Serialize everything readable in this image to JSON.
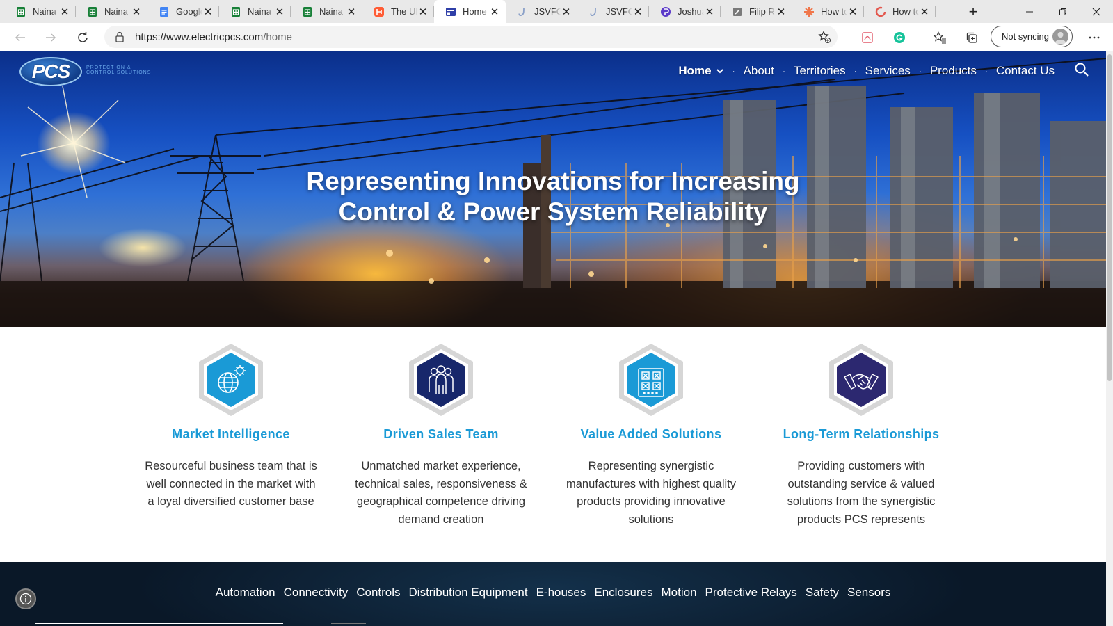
{
  "browser": {
    "tabs": [
      {
        "label": "Naina",
        "icon": "sheets",
        "active": false
      },
      {
        "label": "Naina",
        "icon": "sheets",
        "active": false
      },
      {
        "label": "Google",
        "icon": "docs",
        "active": false
      },
      {
        "label": "Naina",
        "icon": "sheets",
        "active": false
      },
      {
        "label": "Naina",
        "icon": "sheets",
        "active": false
      },
      {
        "label": "The Ul",
        "icon": "hubspot",
        "active": false
      },
      {
        "label": "Home",
        "icon": "site",
        "active": true
      },
      {
        "label": "JSVFO",
        "icon": "jsv",
        "active": false
      },
      {
        "label": "JSVFO",
        "icon": "jsv",
        "active": false
      },
      {
        "label": "Joshua",
        "icon": "purple",
        "active": false
      },
      {
        "label": "Filip R",
        "icon": "gray",
        "active": false
      },
      {
        "label": "How to",
        "icon": "orange",
        "active": false
      },
      {
        "label": "How to",
        "icon": "red",
        "active": false
      }
    ],
    "address": {
      "host": "https://www.electricpcs.com",
      "path": "/home"
    },
    "profile_label": "Not syncing"
  },
  "site": {
    "logo_text": "PCS",
    "logo_tagline": "PROTECTION & CONTROL SOLUTIONS",
    "nav": [
      {
        "label": "Home",
        "active": true
      },
      {
        "label": "About",
        "active": false
      },
      {
        "label": "Territories",
        "active": false
      },
      {
        "label": "Services",
        "active": false
      },
      {
        "label": "Products",
        "active": false
      },
      {
        "label": "Contact Us",
        "active": false
      }
    ],
    "headline_line1": "Representing Innovations for Increasing",
    "headline_line2": "Control & Power System Reliability",
    "features": [
      {
        "title": "Market Intelligence",
        "text": "Resourceful business team that is well connected in the market with a loyal diversified customer base",
        "icon": "globe-gear-icon",
        "color": "#1a9ad6"
      },
      {
        "title": "Driven Sales Team",
        "text": "Unmatched market experience, technical sales, responsiveness & geographical  competence driving demand creation",
        "icon": "team-icon",
        "color": "#17276b"
      },
      {
        "title": "Value Added Solutions",
        "text": "Representing synergistic manufactures with highest quality products providing innovative solutions",
        "icon": "circuit-board-icon",
        "color": "#1a9ad6"
      },
      {
        "title": "Long-Term Relationships",
        "text": "Providing customers with outstanding service & valued solutions from the synergistic products PCS represents",
        "icon": "handshake-icon",
        "color": "#2c2870"
      }
    ],
    "categories": [
      "Automation",
      "Connectivity",
      "Controls",
      "Distribution Equipment",
      "E-houses",
      "Enclosures",
      "Motion",
      "Protective Relays",
      "Safety",
      "Sensors"
    ]
  }
}
